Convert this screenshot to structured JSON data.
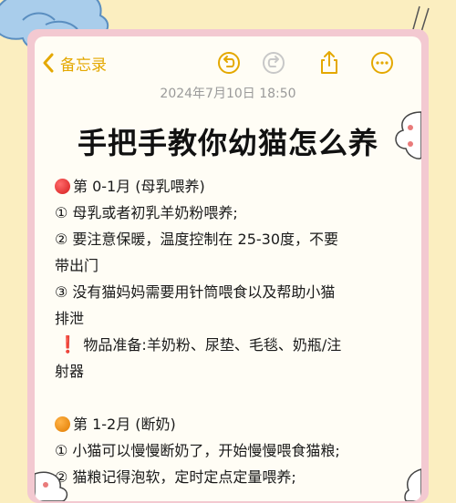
{
  "toolbar": {
    "back_label": "备忘录",
    "accent_color": "#e4a800",
    "icons": [
      "back-chevron-icon",
      "undo-icon",
      "redo-icon",
      "share-icon",
      "more-icon"
    ]
  },
  "note": {
    "date": "2024年7月10日 18:50",
    "title": "手把手教你幼猫怎么养",
    "section1": {
      "heading": "第 0-1月 (母乳喂养)",
      "lines": [
        "① 母乳或者初乳羊奶粉喂养;",
        "② 要注意保暖，温度控制在 25-30度，不要",
        "带出门",
        "③ 没有猫妈妈需要用针筒喂食以及帮助小猫",
        "排泄"
      ],
      "supplies_line1": "物品准备:羊奶粉、尿垫、毛毯、奶瓶/注",
      "supplies_line2": "射器"
    },
    "section2": {
      "heading": "第 1-2月 (断奶)",
      "lines": [
        "① 小猫可以慢慢断奶了，开始慢慢喂食猫粮;",
        "② 猫粮记得泡软，定时定点定量喂养;"
      ]
    }
  }
}
